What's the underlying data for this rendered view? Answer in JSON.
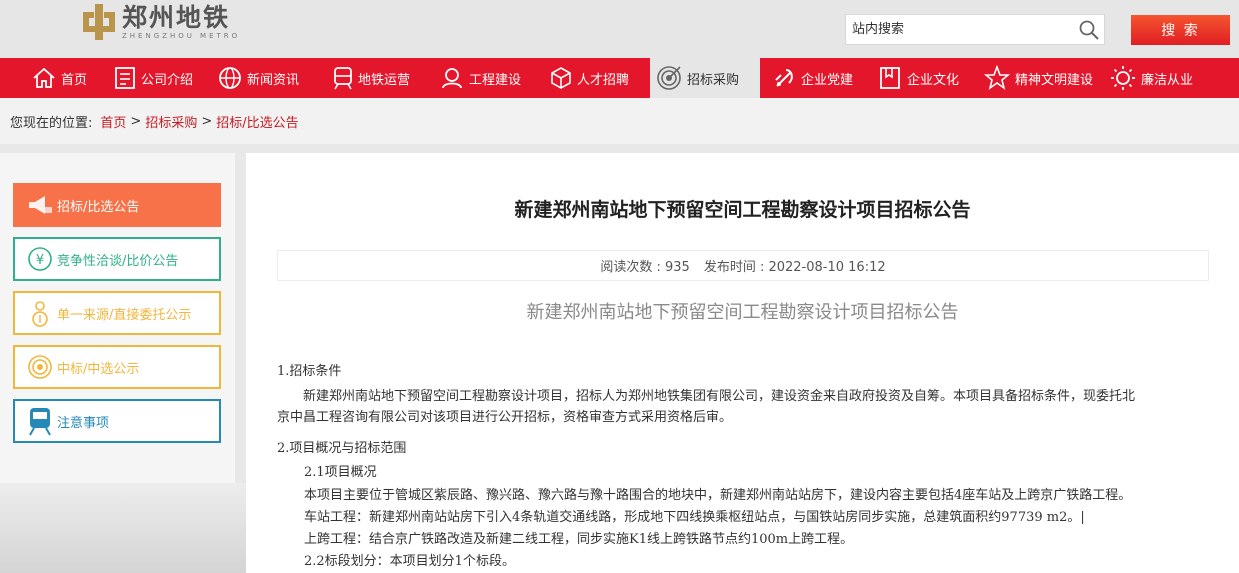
{
  "header": {
    "logo_cn": "郑州地铁",
    "logo_en": "ZHENGZHOU METRO",
    "search_placeholder": "站内搜索",
    "search_button": "搜 索"
  },
  "nav": {
    "items": [
      {
        "label": "首页",
        "icon": "home-icon"
      },
      {
        "label": "公司介绍",
        "icon": "company-icon"
      },
      {
        "label": "新闻资讯",
        "icon": "globe-icon"
      },
      {
        "label": "地铁运营",
        "icon": "train-icon"
      },
      {
        "label": "工程建设",
        "icon": "helmet-icon"
      },
      {
        "label": "人才招聘",
        "icon": "cube-icon"
      },
      {
        "label": "招标采购",
        "icon": "target-icon",
        "active": true
      },
      {
        "label": "企业党建",
        "icon": "party-icon"
      },
      {
        "label": "企业文化",
        "icon": "book-icon"
      },
      {
        "label": "精神文明建设",
        "icon": "star-icon"
      },
      {
        "label": "廉洁从业",
        "icon": "sun-icon"
      }
    ]
  },
  "breadcrumb": {
    "prefix": "您现在的位置:",
    "items": [
      "首页",
      "招标采购",
      "招标/比选公告"
    ],
    "separator": ">"
  },
  "sidebar": {
    "items": [
      {
        "label": "招标/比选公告",
        "color": "#f77249",
        "active": true
      },
      {
        "label": "竞争性洽谈/比价公告",
        "color": "#2fb08a"
      },
      {
        "label": "单一来源/直接委托公示",
        "color": "#f2b63c"
      },
      {
        "label": "中标/中选公示",
        "color": "#f2b63c"
      },
      {
        "label": "注意事项",
        "color": "#2589b8"
      }
    ]
  },
  "article": {
    "title": "新建郑州南站地下预留空间工程勘察设计项目招标公告",
    "read_count_label": "阅读次数 : 935",
    "publish_time_label": "发布时间 : 2022-08-10 16:12",
    "subtitle": "新建郑州南站地下预留空间工程勘察设计项目招标公告",
    "paragraphs": [
      "1.招标条件",
      "新建郑州南站地下预留空间工程勘察设计项目，招标人为郑州地铁集团有限公司，建设资金来自政府投资及自筹。本项目具备招标条件，现委托北",
      "京中昌工程咨询有限公司对该项目进行公开招标，资格审查方式采用资格后审。",
      "2.项目概况与招标范围",
      "2.1项目概况",
      "本项目主要位于管城区紫辰路、豫兴路、豫六路与豫十路围合的地块中，新建郑州南站站房下，建设内容主要包括4座车站及上跨京广铁路工程。",
      "车站工程：新建郑州南站站房下引入4条轨道交通线路，形成地下四线换乘枢纽站点，与国铁站房同步实施，总建筑面积约97739 m2。|",
      "上跨工程：结合京广铁路改造及新建二线工程，同步实施K1线上跨铁路节点约100m上跨工程。",
      "2.2标段划分：本项目划分1个标段。"
    ]
  }
}
